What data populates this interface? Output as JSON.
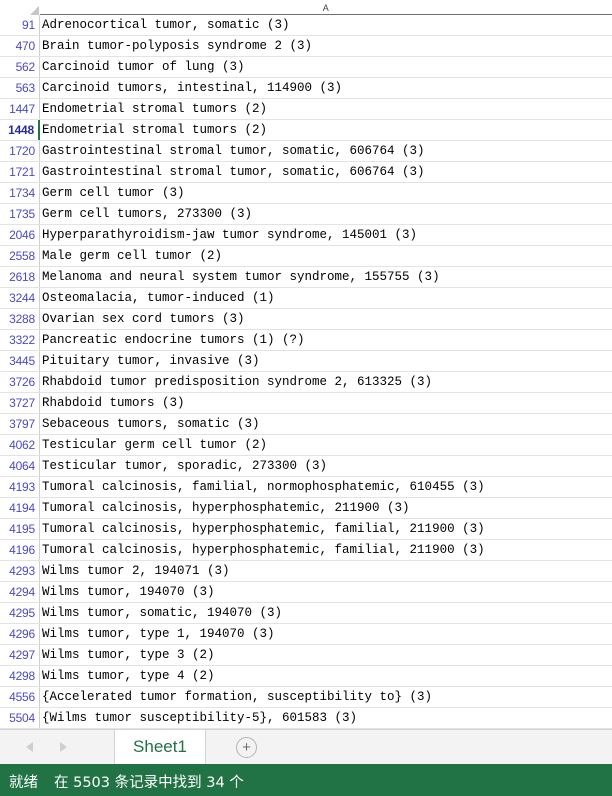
{
  "app": {
    "type": "spreadsheet",
    "accent_color": "#217346",
    "row_header_text_color": "#4a4ac0",
    "gridline_color": "#e3e3e3",
    "active_cell_border_color": "#217346"
  },
  "column_headers": {
    "select_all_icon": "select-all-triangle-icon",
    "columns": [
      "A"
    ]
  },
  "rows": [
    {
      "num": "91",
      "a": "Adrenocortical tumor, somatic (3)",
      "active": false
    },
    {
      "num": "470",
      "a": "Brain tumor-polyposis syndrome 2 (3)",
      "active": false
    },
    {
      "num": "562",
      "a": "Carcinoid tumor of lung (3)",
      "active": false
    },
    {
      "num": "563",
      "a": "Carcinoid tumors, intestinal, 114900 (3)",
      "active": false
    },
    {
      "num": "1447",
      "a": "Endometrial stromal tumors (2)",
      "active": false
    },
    {
      "num": "1448",
      "a": "Endometrial stromal tumors (2)",
      "active": true
    },
    {
      "num": "1720",
      "a": "Gastrointestinal stromal tumor, somatic, 606764 (3)",
      "active": false
    },
    {
      "num": "1721",
      "a": "Gastrointestinal stromal tumor, somatic, 606764 (3)",
      "active": false
    },
    {
      "num": "1734",
      "a": "Germ cell tumor (3)",
      "active": false
    },
    {
      "num": "1735",
      "a": "Germ cell tumors, 273300 (3)",
      "active": false
    },
    {
      "num": "2046",
      "a": "Hyperparathyroidism-jaw tumor syndrome, 145001 (3)",
      "active": false
    },
    {
      "num": "2558",
      "a": "Male germ cell tumor (2)",
      "active": false
    },
    {
      "num": "2618",
      "a": "Melanoma and neural system tumor syndrome, 155755 (3)",
      "active": false
    },
    {
      "num": "3244",
      "a": "Osteomalacia, tumor-induced (1)",
      "active": false
    },
    {
      "num": "3288",
      "a": "Ovarian sex cord tumors (3)",
      "active": false
    },
    {
      "num": "3322",
      "a": "Pancreatic endocrine tumors (1) (?)",
      "active": false
    },
    {
      "num": "3445",
      "a": "Pituitary tumor, invasive (3)",
      "active": false
    },
    {
      "num": "3726",
      "a": "Rhabdoid tumor predisposition syndrome 2, 613325 (3)",
      "active": false
    },
    {
      "num": "3727",
      "a": "Rhabdoid tumors (3)",
      "active": false
    },
    {
      "num": "3797",
      "a": "Sebaceous tumors, somatic (3)",
      "active": false
    },
    {
      "num": "4062",
      "a": "Testicular germ cell tumor (2)",
      "active": false
    },
    {
      "num": "4064",
      "a": "Testicular tumor, sporadic, 273300 (3)",
      "active": false
    },
    {
      "num": "4193",
      "a": "Tumoral calcinosis, familial, normophosphatemic, 610455 (3)",
      "active": false
    },
    {
      "num": "4194",
      "a": "Tumoral calcinosis, hyperphosphatemic, 211900 (3)",
      "active": false
    },
    {
      "num": "4195",
      "a": "Tumoral calcinosis, hyperphosphatemic, familial, 211900 (3)",
      "active": false
    },
    {
      "num": "4196",
      "a": "Tumoral calcinosis, hyperphosphatemic, familial, 211900 (3)",
      "active": false
    },
    {
      "num": "4293",
      "a": "Wilms tumor 2, 194071 (3)",
      "active": false
    },
    {
      "num": "4294",
      "a": "Wilms tumor, 194070 (3)",
      "active": false
    },
    {
      "num": "4295",
      "a": "Wilms tumor, somatic, 194070 (3)",
      "active": false
    },
    {
      "num": "4296",
      "a": "Wilms tumor, type 1, 194070 (3)",
      "active": false
    },
    {
      "num": "4297",
      "a": "Wilms tumor, type 3 (2)",
      "active": false
    },
    {
      "num": "4298",
      "a": "Wilms tumor, type 4 (2)",
      "active": false
    },
    {
      "num": "4556",
      "a": "{Accelerated tumor formation, susceptibility to} (3)",
      "active": false
    },
    {
      "num": "5504",
      "a": "{Wilms tumor susceptibility-5}, 601583 (3)",
      "active": false
    }
  ],
  "tabbar": {
    "prev_icon": "chevron-left-icon",
    "next_icon": "chevron-right-icon",
    "sheets": [
      {
        "name": "Sheet1",
        "active": true
      }
    ],
    "add_sheet_label": "+",
    "add_sheet_icon": "plus-circle-icon"
  },
  "statusbar": {
    "ready_label": "就绪",
    "message": "在 5503 条记录中找到 34 个",
    "record_total": "5503",
    "found_count": "34"
  }
}
